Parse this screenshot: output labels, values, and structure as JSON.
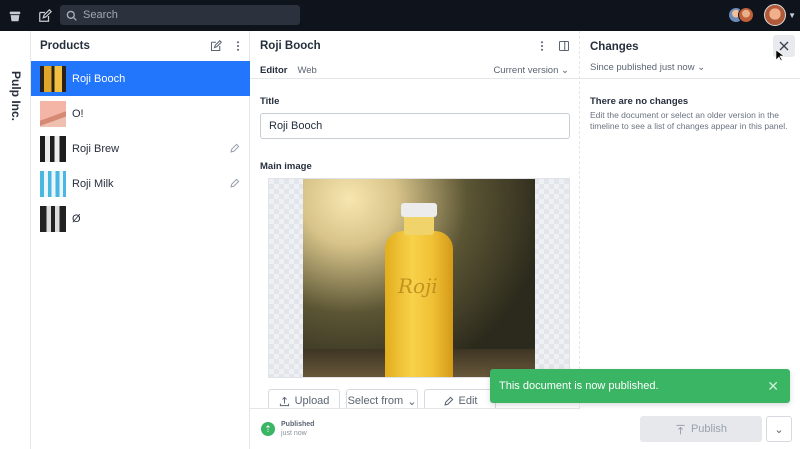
{
  "topbar": {
    "search_placeholder": "Search"
  },
  "brand": {
    "name": "Pulp Inc."
  },
  "products": {
    "title": "Products",
    "items": [
      {
        "name": "Roji Booch",
        "selected": true
      },
      {
        "name": "O!",
        "selected": false
      },
      {
        "name": "Roji Brew",
        "selected": false,
        "draft": true
      },
      {
        "name": "Roji Milk",
        "selected": false,
        "draft": true
      },
      {
        "name": "Ø",
        "selected": false
      }
    ]
  },
  "editor": {
    "title": "Roji Booch",
    "tabs": [
      {
        "label": "Editor",
        "active": true
      },
      {
        "label": "Web",
        "active": false
      }
    ],
    "version_label": "Current version",
    "fields": {
      "title_label": "Title",
      "title_value": "Roji Booch",
      "image_label": "Main image",
      "image_subject": "Roji"
    },
    "image_buttons": {
      "upload": "Upload",
      "select": "Select from",
      "edit": "Edit"
    },
    "status": {
      "state": "Published",
      "time": "just now"
    },
    "publish_label": "Publish"
  },
  "changes": {
    "title": "Changes",
    "since_label": "Since published just now",
    "empty_title": "There are no changes",
    "empty_desc": "Edit the document or select an older version in the timeline to see a list of changes appear in this panel."
  },
  "toast": {
    "message": "This document is now published."
  },
  "colors": {
    "accent": "#2276fc",
    "success": "#3ab564",
    "topbar": "#0f131c"
  }
}
